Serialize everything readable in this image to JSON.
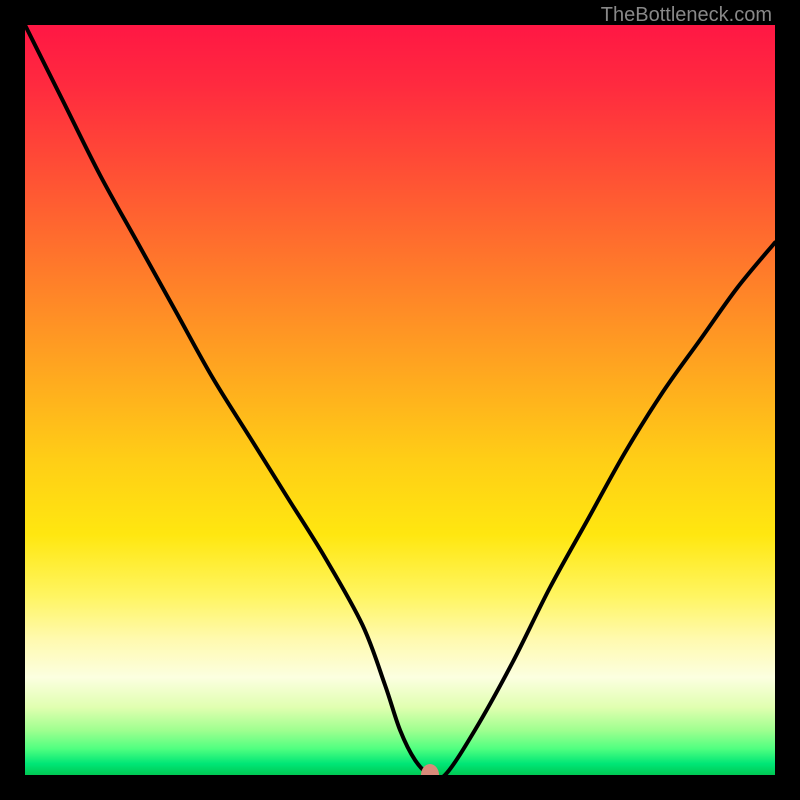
{
  "watermark": "TheBottleneck.com",
  "chart_data": {
    "type": "line",
    "title": "",
    "xlabel": "",
    "ylabel": "",
    "xlim": [
      0,
      100
    ],
    "ylim": [
      0,
      100
    ],
    "background_gradient": {
      "direction": "vertical",
      "stops": [
        {
          "pos": 0,
          "color": "#ff1744"
        },
        {
          "pos": 50,
          "color": "#ffce16"
        },
        {
          "pos": 85,
          "color": "#fffab0"
        },
        {
          "pos": 100,
          "color": "#00c853"
        }
      ]
    },
    "series": [
      {
        "name": "bottleneck-curve",
        "color": "#000000",
        "x": [
          0,
          5,
          10,
          15,
          20,
          25,
          30,
          35,
          40,
          45,
          48,
          50,
          52,
          54,
          56,
          60,
          65,
          70,
          75,
          80,
          85,
          90,
          95,
          100
        ],
        "y": [
          100,
          90,
          80,
          71,
          62,
          53,
          45,
          37,
          29,
          20,
          12,
          6,
          2,
          0,
          0,
          6,
          15,
          25,
          34,
          43,
          51,
          58,
          65,
          71
        ]
      }
    ],
    "marker": {
      "name": "optimal-point",
      "x": 54,
      "y": 0,
      "color": "#d98a7a",
      "shape": "ellipse"
    }
  }
}
